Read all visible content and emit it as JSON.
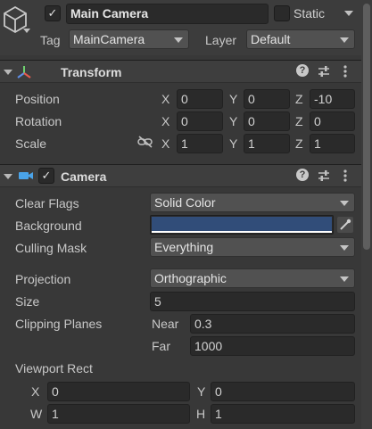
{
  "gameobject": {
    "name": "Main Camera",
    "active_checked": "✓",
    "static_label": "Static",
    "tag_label": "Tag",
    "tag_value": "MainCamera",
    "layer_label": "Layer",
    "layer_value": "Default"
  },
  "transform": {
    "title": "Transform",
    "position_label": "Position",
    "rotation_label": "Rotation",
    "scale_label": "Scale",
    "position": {
      "x": "0",
      "y": "0",
      "z": "-10"
    },
    "rotation": {
      "x": "0",
      "y": "0",
      "z": "0"
    },
    "scale": {
      "x": "1",
      "y": "1",
      "z": "1"
    }
  },
  "camera": {
    "title": "Camera",
    "enabled_checked": "✓",
    "clear_flags_label": "Clear Flags",
    "clear_flags_value": "Solid Color",
    "background_label": "Background",
    "background_color": "#314d79",
    "culling_mask_label": "Culling Mask",
    "culling_mask_value": "Everything",
    "projection_label": "Projection",
    "projection_value": "Orthographic",
    "size_label": "Size",
    "size_value": "5",
    "clipping_planes_label": "Clipping Planes",
    "near_label": "Near",
    "near_value": "0.3",
    "far_label": "Far",
    "far_value": "1000",
    "viewport_rect_label": "Viewport Rect",
    "viewport": {
      "x": "0",
      "y": "0",
      "w": "1",
      "h": "1"
    }
  },
  "axes": {
    "x": "X",
    "y": "Y",
    "z": "Z",
    "w": "W",
    "h": "H"
  },
  "icons": {
    "gameobject": "cube-icon",
    "transform": "transform-axes-icon",
    "camera": "camera-icon",
    "help": "help-icon",
    "presets": "presets-icon",
    "menu": "kebab-menu-icon",
    "constrain": "link-icon",
    "eyedropper": "eyedropper-icon"
  }
}
